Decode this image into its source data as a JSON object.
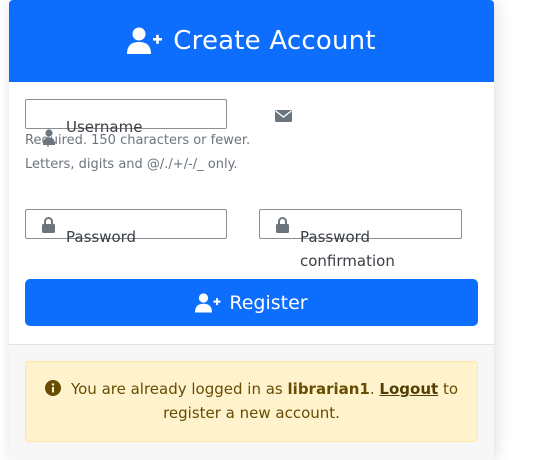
{
  "header": {
    "title": "Create Account",
    "icon": "user-plus-icon"
  },
  "form": {
    "username": {
      "label": "Username",
      "help_line1": "Required. 150 characters or fewer.",
      "help_line2": "Letters, digits and @/./+/-/_ only.",
      "value": ""
    },
    "email": {
      "icon": "envelope-icon"
    },
    "password": {
      "label": "Password",
      "value": ""
    },
    "password_confirmation": {
      "label_line1": "Password",
      "label_line2": "confirmation",
      "value": ""
    },
    "submit": {
      "label": "Register",
      "icon": "user-plus-icon"
    }
  },
  "alert": {
    "prefix": "You are already logged in as",
    "username": "librarian1",
    "period": ".",
    "logout_label": "Logout",
    "suffix_line1": "to",
    "suffix_line2": "register a new account.",
    "icon": "info-circle-icon"
  },
  "colors": {
    "primary": "#0d6efd",
    "alert_bg": "#fff3cd",
    "alert_text": "#664d03"
  }
}
